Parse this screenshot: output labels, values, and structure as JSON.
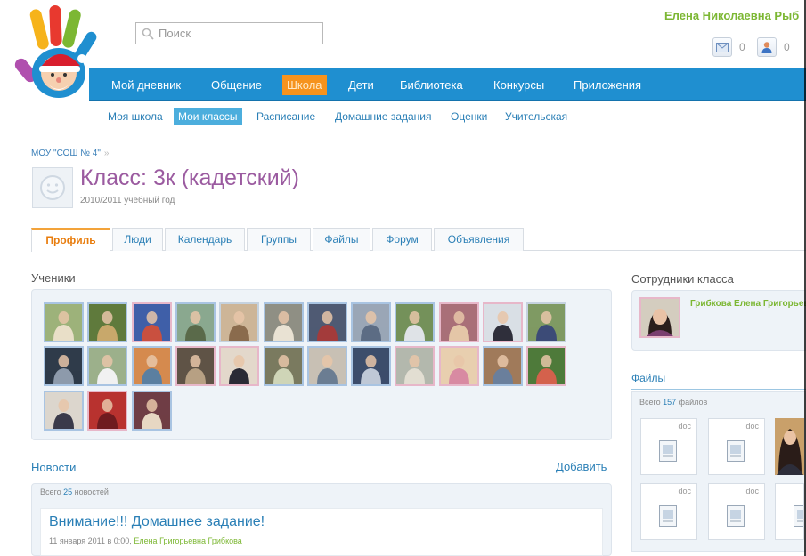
{
  "search": {
    "placeholder": "Поиск"
  },
  "user": {
    "name": "Елена Николаевна Рыб",
    "messages_count": "0",
    "friends_count": "0"
  },
  "main_nav": [
    {
      "label": "Мой дневник"
    },
    {
      "label": "Общение"
    },
    {
      "label": "Школа",
      "active": true
    },
    {
      "label": "Дети"
    },
    {
      "label": "Библиотека"
    },
    {
      "label": "Конкурсы"
    },
    {
      "label": "Приложения"
    }
  ],
  "sub_nav": [
    {
      "label": "Моя школа"
    },
    {
      "label": "Мои классы",
      "active": true
    },
    {
      "label": "Расписание"
    },
    {
      "label": "Домашние задания"
    },
    {
      "label": "Оценки"
    },
    {
      "label": "Учительская"
    }
  ],
  "breadcrumb": {
    "school": "МОУ \"СОШ № 4\"",
    "separator": "»"
  },
  "page": {
    "title": "Класс: 3к (кадетский)",
    "year": "2010/2011 учебный год"
  },
  "tabs": [
    {
      "label": "Профиль",
      "active": true
    },
    {
      "label": "Люди"
    },
    {
      "label": "Календарь"
    },
    {
      "label": "Группы"
    },
    {
      "label": "Файлы"
    },
    {
      "label": "Форум"
    },
    {
      "label": "Объявления"
    }
  ],
  "students": {
    "title": "Ученики",
    "photos": [
      {
        "bg": "#9db27a",
        "fg": "#e9dfc8",
        "frame": "blue"
      },
      {
        "bg": "#5f7a3c",
        "fg": "#c8a86b",
        "frame": "blue"
      },
      {
        "bg": "#3f5fa8",
        "fg": "#c9503f",
        "frame": "pink"
      },
      {
        "bg": "#8aa88f",
        "fg": "#5a6a4a",
        "frame": "blue"
      },
      {
        "bg": "#cdb597",
        "fg": "#8a6b4d",
        "frame": "pale"
      },
      {
        "bg": "#8f8f84",
        "fg": "#e9e2d3",
        "frame": "blue"
      },
      {
        "bg": "#4f5a73",
        "fg": "#a33b3b",
        "frame": "blue"
      },
      {
        "bg": "#9aa6b6",
        "fg": "#5c6c84",
        "frame": "blue"
      },
      {
        "bg": "#74915a",
        "fg": "#dfe3e7",
        "frame": "blue"
      },
      {
        "bg": "#a96f78",
        "fg": "#e4c6a7",
        "frame": "pink"
      },
      {
        "bg": "#d9dfe5",
        "fg": "#2f2f3b",
        "frame": "pink"
      },
      {
        "bg": "#7f9a63",
        "fg": "#3c4b77",
        "frame": "pale"
      },
      {
        "bg": "#2f3b4a",
        "fg": "#8d9aab",
        "frame": "blue"
      },
      {
        "bg": "#9cb08b",
        "fg": "#f1f1f1",
        "frame": "blue"
      },
      {
        "bg": "#d58a4e",
        "fg": "#5b7fa0",
        "frame": "blue"
      },
      {
        "bg": "#5f5346",
        "fg": "#b7a083",
        "frame": "pink"
      },
      {
        "bg": "#e3d8cb",
        "fg": "#2a2a35",
        "frame": "pink"
      },
      {
        "bg": "#7a7a5f",
        "fg": "#cfd5b7",
        "frame": "blue"
      },
      {
        "bg": "#c8c0b4",
        "fg": "#6b7d92",
        "frame": "blue"
      },
      {
        "bg": "#3c4d6b",
        "fg": "#bfc8d6",
        "frame": "blue"
      },
      {
        "bg": "#b3b8ad",
        "fg": "#e2ded2",
        "frame": "pink"
      },
      {
        "bg": "#e8cfaf",
        "fg": "#d88aa2",
        "frame": "pink"
      },
      {
        "bg": "#a07a5a",
        "fg": "#6a7f9c",
        "frame": "blue"
      },
      {
        "bg": "#4e7a3a",
        "fg": "#d4614c",
        "frame": "pink"
      },
      {
        "bg": "#dcd6cd",
        "fg": "#3a3a4a",
        "frame": "blue"
      },
      {
        "bg": "#b8322f",
        "fg": "#6f1b1f",
        "frame": "pink"
      },
      {
        "bg": "#6f3d45",
        "fg": "#e7d7c3",
        "frame": "blue"
      }
    ]
  },
  "news": {
    "title": "Новости",
    "add_label": "Добавить",
    "count_prefix": "Всего",
    "count": "25",
    "count_suffix": "новостей",
    "items": [
      {
        "title": "Внимание!!! Домашнее задание!",
        "date": "11 января 2011 в 0:00,",
        "author": "Елена Григорьевна Грибкова"
      }
    ]
  },
  "staff": {
    "title": "Сотрудники класса",
    "members": [
      {
        "name": "Грибкова Елена Григорьевна"
      }
    ]
  },
  "files": {
    "title": "Файлы",
    "count_prefix": "Всего",
    "count": "157",
    "count_suffix": "файлов",
    "items": [
      {
        "type": "doc"
      },
      {
        "type": "doc"
      },
      {
        "type": "photo"
      },
      {
        "type": "doc"
      },
      {
        "type": "doc"
      },
      {
        "type": "doc-partial"
      }
    ]
  },
  "colors": {
    "nav_blue": "#1f8fd0",
    "nav_active": "#f6931d",
    "subnav_active": "#4caedd",
    "link": "#2a7fb6",
    "title_purple": "#9b5ba0",
    "user_green": "#7cb733",
    "tab_active": "#e87d0e"
  },
  "icons": {
    "logo": "santa-hand-logo-icon",
    "search": "magnifier-icon",
    "messages": "envelope-icon",
    "friends": "person-icon",
    "class_avatar": "smiley-placeholder-icon",
    "file": "doc-file-icon"
  }
}
